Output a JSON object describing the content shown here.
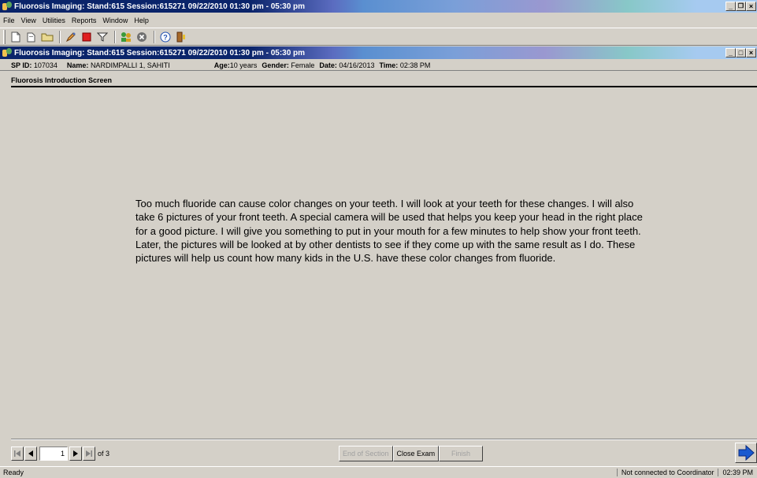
{
  "app": {
    "outer_title": "Fluorosis Imaging: Stand:615 Session:615271 09/22/2010 01:30 pm - 05:30 pm",
    "inner_title": "Fluorosis Imaging: Stand:615 Session:615271 09/22/2010 01:30 pm - 05:30 pm"
  },
  "menu": [
    "File",
    "View",
    "Utilities",
    "Reports",
    "Window",
    "Help"
  ],
  "toolbar_icons": [
    "new-document-icon",
    "open-folder-icon",
    "folder-icon",
    "edit-icon",
    "stop-icon",
    "filter-icon",
    "people-icon",
    "close-circle-icon",
    "help-icon",
    "exit-door-icon"
  ],
  "patient": {
    "sp_id_label": "SP ID:",
    "sp_id": "107034",
    "name_label": "Name:",
    "name": "NARDIMPALLI 1, SAHITI",
    "age_label": "Age:",
    "age": "10 years",
    "gender_label": "Gender:",
    "gender": "Female",
    "date_label": "Date:",
    "date": "04/16/2013",
    "time_label": "Time:",
    "time": "02:38 PM"
  },
  "screen": {
    "title": "Fluorosis Introduction Screen",
    "body": "Too much fluoride can cause color changes on your teeth.  I will look at your teeth for these changes.  I will also take 6 pictures of your front teeth.  A special camera will be used that helps you keep your head in the right place for a good picture.  I will give you something to put in your mouth for a few minutes to help show your front teeth.  Later, the pictures will be looked at by other dentists to see if they come up with the same result as I do.  These pictures will help us count how many kids in the U.S. have these color changes from fluoride."
  },
  "navigation": {
    "page": "1",
    "of_label": "of 3"
  },
  "actions": {
    "end_of_section": "End of Section",
    "close_exam": "Close Exam",
    "finish": "Finish"
  },
  "status": {
    "ready": "Ready",
    "connection": "Not connected to Coordinator",
    "clock": "02:39 PM"
  },
  "window_buttons": {
    "minimize": "_",
    "maximize": "□",
    "close": "×"
  }
}
